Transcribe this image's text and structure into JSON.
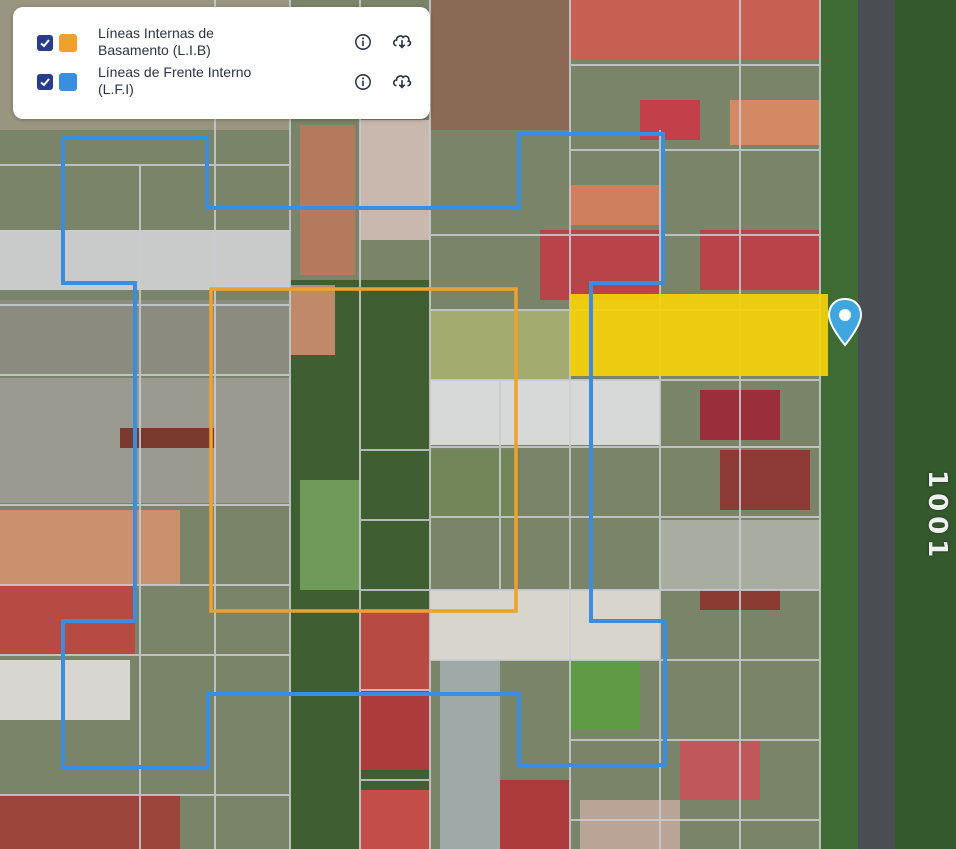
{
  "legend": {
    "layers": [
      {
        "id": "lib",
        "checked": true,
        "color": "#f0a12a",
        "label_line1": "Líneas Internas de",
        "label_line2": "Basamento (L.I.B)",
        "info_icon": "info-icon",
        "download_icon": "cloud-download-icon"
      },
      {
        "id": "lfi",
        "checked": true,
        "color": "#3a8ee2",
        "label_line1": "Líneas de Frente Interno",
        "label_line2": "(L.F.I)",
        "info_icon": "info-icon",
        "download_icon": "cloud-download-icon"
      }
    ]
  },
  "map": {
    "street_number": "1001",
    "marker_icon": "map-pin-icon",
    "marker_color": "#3fa6e0",
    "highlight_color": "#f4d20a",
    "lib_line_color": "#f0a12a",
    "lfi_line_color": "#3a8ee2",
    "lot_line_color": "#c9ccd1"
  }
}
